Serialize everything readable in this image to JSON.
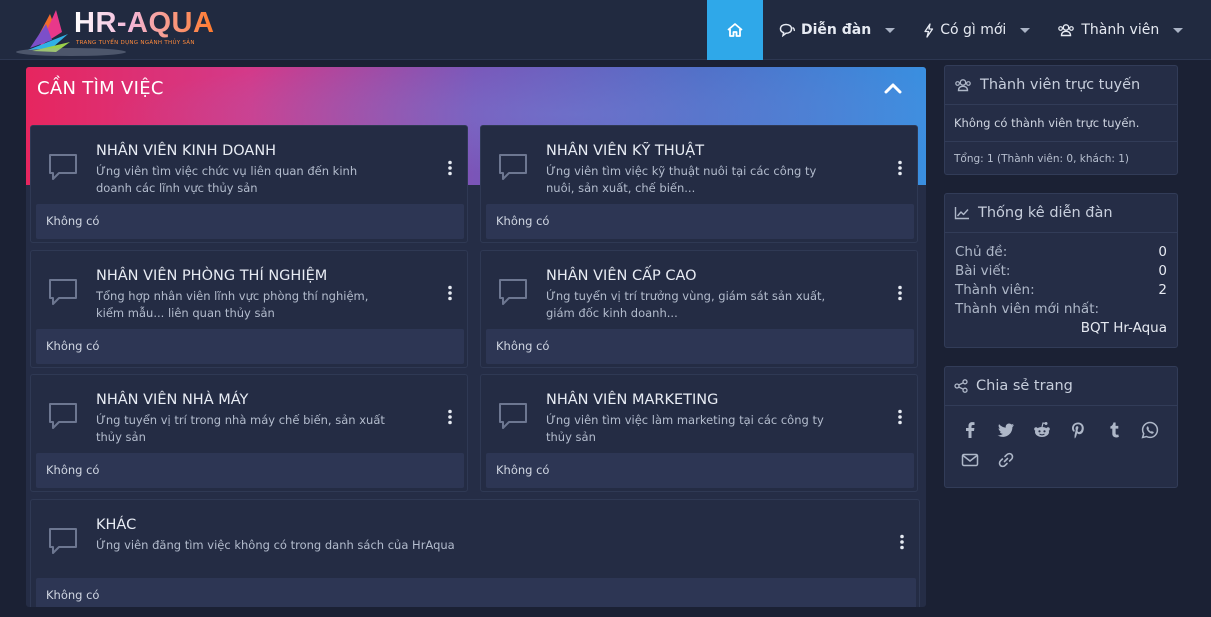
{
  "brand": {
    "logo_text": "HR-AQUA",
    "tagline": "TRANG TUYỂN DỤNG NGÀNH THỦY SẢN"
  },
  "nav": {
    "home_icon": "home-icon",
    "items": [
      {
        "label": "Diễn đàn",
        "icon": "comments-icon"
      },
      {
        "label": "Có gì mới",
        "icon": "bolt-icon"
      },
      {
        "label": "Thành viên",
        "icon": "users-icon"
      }
    ]
  },
  "category": {
    "title": "CẦN TÌM VIỆC",
    "forums": [
      {
        "title": "NHÂN VIÊN KINH DOANH",
        "description": "Ứng viên tìm việc chức vụ liên quan đến kinh doanh các lĩnh vực thủy sản",
        "latest": "Không có"
      },
      {
        "title": "NHÂN VIÊN KỸ THUẬT",
        "description": "Ứng viên tìm việc kỹ thuật nuôi tại các công ty nuôi, sản xuất, chế biến...",
        "latest": "Không có"
      },
      {
        "title": "NHÂN VIÊN PHÒNG THÍ NGHIỆM",
        "description": "Tổng hợp nhân viên lĩnh vực phòng thí nghiệm, kiểm mẫu... liên quan thủy sản",
        "latest": "Không có"
      },
      {
        "title": "NHÂN VIÊN CẤP CAO",
        "description": "Ứng tuyển vị trí trưởng vùng, giám sát sản xuất, giám đốc kinh doanh...",
        "latest": "Không có"
      },
      {
        "title": "NHÂN VIÊN NHÀ MÁY",
        "description": "Ứng tuyển vị trí trong nhà máy chế biến, sản xuất thủy sản",
        "latest": "Không có"
      },
      {
        "title": "NHÂN VIÊN MARKETING",
        "description": "Ứng viên tìm việc làm marketing tại các công ty thủy sản",
        "latest": "Không có"
      },
      {
        "title": "KHÁC",
        "description": "Ứng viên đăng tìm việc không có trong danh sách của HrAqua",
        "latest": "Không có"
      }
    ]
  },
  "online": {
    "title": "Thành viên trực tuyến",
    "empty": "Không có thành viên trực tuyến.",
    "total": "Tổng: 1 (Thành viên: 0, khách: 1)"
  },
  "stats": {
    "title": "Thống kê diễn đàn",
    "rows": [
      {
        "label": "Chủ đề:",
        "value": "0"
      },
      {
        "label": "Bài viết:",
        "value": "0"
      },
      {
        "label": "Thành viên:",
        "value": "2"
      }
    ],
    "newest_label": "Thành viên mới nhất:",
    "newest_value": "BQT Hr-Aqua"
  },
  "share": {
    "title": "Chia sẻ trang",
    "icons": [
      "facebook-icon",
      "twitter-icon",
      "reddit-icon",
      "pinterest-icon",
      "tumblr-icon",
      "whatsapp-icon",
      "email-icon",
      "link-icon"
    ]
  },
  "colors": {
    "page_bg": "#1b2134",
    "header_bg": "#212a40",
    "accent": "#2fa8e9",
    "card_bg": "#242c44",
    "footer_bg": "#2d3654"
  }
}
